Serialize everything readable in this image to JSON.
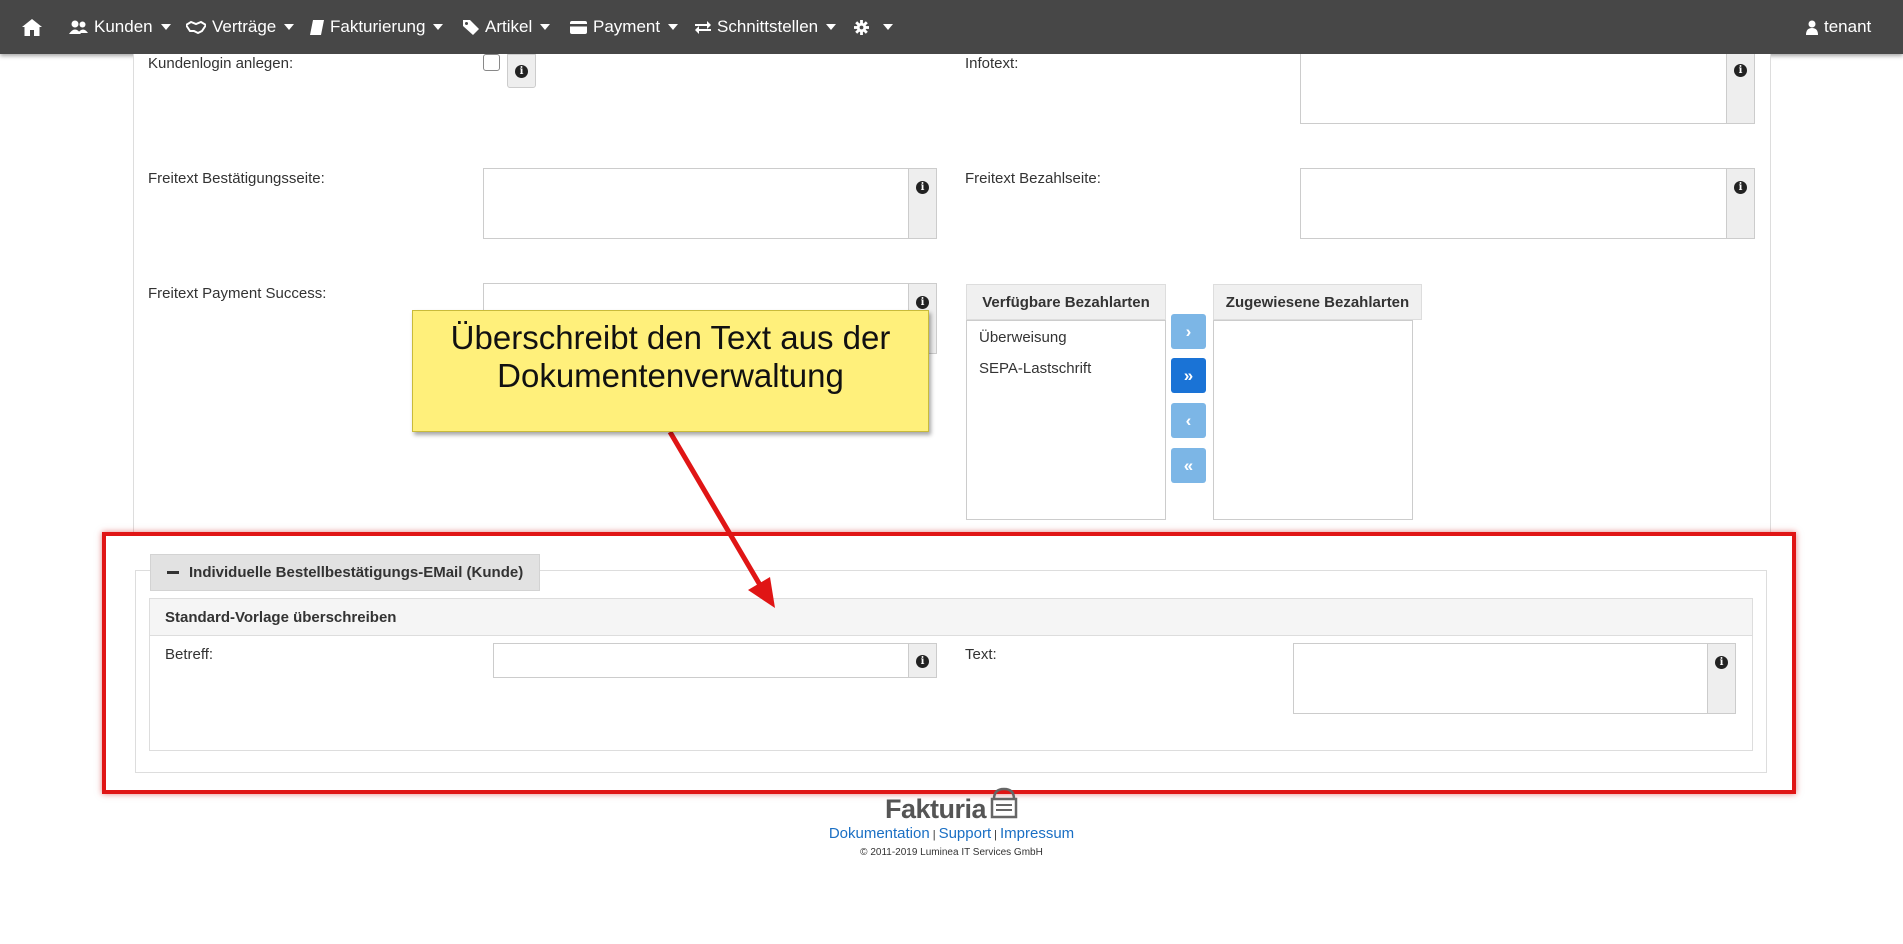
{
  "nav": {
    "items": [
      {
        "label": "Kunden",
        "icon": "users-icon"
      },
      {
        "label": "Verträge",
        "icon": "handshake-icon"
      },
      {
        "label": "Fakturierung",
        "icon": "book-icon"
      },
      {
        "label": "Artikel",
        "icon": "tags-icon"
      },
      {
        "label": "Payment",
        "icon": "credit-card-icon"
      },
      {
        "label": "Schnittstellen",
        "icon": "exchange-icon"
      }
    ],
    "user": "tenant"
  },
  "form": {
    "kundenlogin_label": "Kundenlogin anlegen:",
    "infotext_label": "Infotext:",
    "freitext_bestaetigung_label": "Freitext Bestätigungsseite:",
    "freitext_bezahl_label": "Freitext Bezahlseite:",
    "freitext_success_label": "Freitext Payment Success:"
  },
  "payment_methods": {
    "available_header": "Verfügbare Bezahlarten",
    "assigned_header": "Zugewiesene Bezahlarten",
    "available": [
      "Überweisung",
      "SEPA-Lastschrift"
    ],
    "assigned": [],
    "buttons": {
      "add": "›",
      "add_all": "»",
      "remove": "‹",
      "remove_all": "«"
    }
  },
  "email_section": {
    "legend": "Individuelle Bestellbestätigungs-EMail (Kunde)",
    "panel_title": "Standard-Vorlage überschreiben",
    "betreff_label": "Betreff:",
    "text_label": "Text:"
  },
  "annotation": {
    "text_line1": "Überschreibt den Text aus der",
    "text_line2": "Dokumentenverwaltung"
  },
  "footer": {
    "logo": "Fakturia",
    "links": [
      "Dokumentation",
      "Support",
      "Impressum"
    ],
    "separator": "|",
    "copyright": "© 2011-2019 Luminea IT Services GmbH"
  },
  "colors": {
    "navbar": "#474747",
    "accent_blue": "#1a73d6",
    "light_blue": "#7cb6e6",
    "callout_yellow": "#fff07b",
    "highlight_red": "#e01515"
  }
}
